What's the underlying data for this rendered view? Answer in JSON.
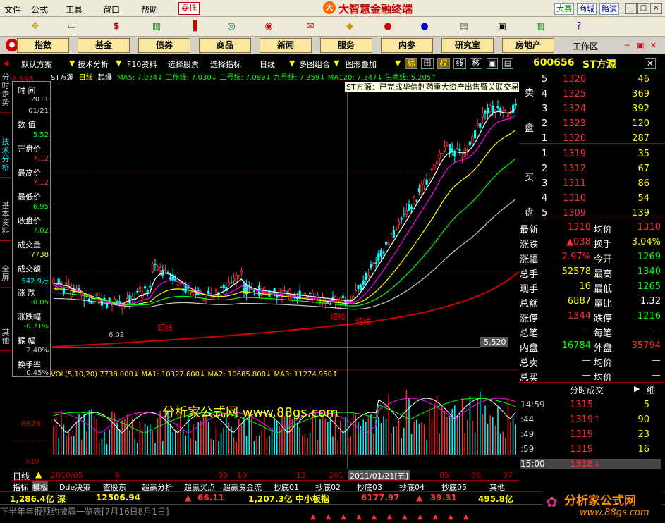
{
  "menubar": {
    "items": [
      "文件",
      "公式",
      "工具",
      "窗口",
      "帮助"
    ],
    "weituo": "委托",
    "brand": "大智慧金融终端",
    "right": [
      "大赛",
      "商城",
      "路演"
    ]
  },
  "navbar": {
    "items": [
      "指数",
      "基金",
      "债券",
      "商品",
      "新闻",
      "服务",
      "内参",
      "研究室",
      "房地产"
    ],
    "workspace": "工作区"
  },
  "toolbar": {
    "items": [
      "默认方案",
      "技术分析",
      "F10资料",
      "选择股票",
      "选择指标",
      "日线",
      "多图组合",
      "图形叠加"
    ],
    "small": [
      "标",
      "田",
      "权",
      "线",
      "移"
    ]
  },
  "stock": {
    "code": "600656",
    "name": "ST方源"
  },
  "indicator": {
    "name": "ST方源",
    "period": "日线",
    "ref": "起爆",
    "line": "MA5: 7.034↓ 工作线: 7.030↓ 二号线: 7.089↓ 九号线: 7.359↓ MA120: 7.347↓ 生命线: 5.205↑"
  },
  "news": "ST方源：已完成华信制药重大资产出售暨关联交易100%股权过户",
  "info": {
    "labels": [
      "时  间",
      "数  值",
      "开盘价",
      "最高价",
      "最低价",
      "收盘价",
      "成交量",
      "成交额",
      "涨  跌",
      "涨跌幅",
      "振  幅",
      "换手率"
    ],
    "values": [
      "2011",
      "01/21",
      "5.52",
      "7.12",
      "7.12",
      "6.95",
      "7.02",
      "7738",
      "542.9万",
      "-0.05",
      "-0.71%",
      "2.40%",
      "0.45%"
    ]
  },
  "chart_labels": {
    "low": "6.02",
    "short1": "短线",
    "short2": "短线",
    "short3": "短线",
    "price": "5.520",
    "left_price": "4.598"
  },
  "vol": {
    "line": "VOL(5,10,20) 7738.000↓ MA1: 10327.600↓ MA2: 10685.800↓ MA3: 11274.950↑",
    "watermark": "分析家公式网 www.88gs.com",
    "axis": "8878",
    "x10": "X10"
  },
  "dateaxis": {
    "labels": [
      "2010/05",
      "6",
      "09",
      "10",
      "12",
      "201"
    ],
    "cursor": "2011/01/21[五]",
    "right": [
      "05",
      "06",
      "07"
    ],
    "period": "日线"
  },
  "bottabs": [
    "指标",
    "模板",
    "Dde决策",
    "查股东",
    "超赢分析",
    "超赢买点",
    "超赢资金流",
    "抄底01",
    "抄底02",
    "抄底03",
    "抄底04",
    "抄底05",
    "其他"
  ],
  "ticker": {
    "sh": "1,286.4亿 深",
    "sh_val": "12506.94",
    "sh_chg": "66.11",
    "sm": "1,207.3亿 中小板指",
    "sm_val": "6177.97",
    "sm_chg": "39.31",
    "last": "495.8亿"
  },
  "status": {
    "text": "下半年年报预约披露一览表[7月16日8月1日]",
    "logo": "分析家公式网",
    "url": "www.88gs.com"
  },
  "sell": [
    {
      "n": "5",
      "p": "1326",
      "v": "46"
    },
    {
      "n": "4",
      "p": "1325",
      "v": "369"
    },
    {
      "n": "3",
      "p": "1324",
      "v": "392"
    },
    {
      "n": "2",
      "p": "1323",
      "v": "120"
    },
    {
      "n": "1",
      "p": "1320",
      "v": "287"
    }
  ],
  "buy": [
    {
      "n": "1",
      "p": "1319",
      "v": "35"
    },
    {
      "n": "2",
      "p": "1312",
      "v": "67"
    },
    {
      "n": "3",
      "p": "1311",
      "v": "86"
    },
    {
      "n": "4",
      "p": "1310",
      "v": "54"
    },
    {
      "n": "5",
      "p": "1309",
      "v": "139"
    }
  ],
  "book_labels": {
    "sell": "卖盘",
    "buy": "买盘"
  },
  "stats": [
    {
      "k1": "最新",
      "v1": "1318",
      "k2": "均价",
      "v2": "1310"
    },
    {
      "k1": "涨跌",
      "v1": "▲038",
      "k2": "换手",
      "v2": "3.04%"
    },
    {
      "k1": "涨幅",
      "v1": "2.97%",
      "k2": "今开",
      "v2": "1269"
    },
    {
      "k1": "总手",
      "v1": "52578",
      "k2": "最高",
      "v2": "1340"
    },
    {
      "k1": "现手",
      "v1": "16",
      "k2": "最低",
      "v2": "1265"
    },
    {
      "k1": "总额",
      "v1": "6887",
      "k2": "量比",
      "v2": "1.32"
    },
    {
      "k1": "涨停",
      "v1": "1344",
      "k2": "跌停",
      "v2": "1216"
    },
    {
      "k1": "总笔",
      "v1": "—",
      "k2": "每笔",
      "v2": "—"
    },
    {
      "k1": "内盘",
      "v1": "16784",
      "k2": "外盘",
      "v2": "35794"
    },
    {
      "k1": "总卖",
      "v1": "—",
      "k2": "均价",
      "v2": "—"
    },
    {
      "k1": "总买",
      "v1": "—",
      "k2": "均价",
      "v2": "—"
    }
  ],
  "ticks": {
    "title": "分时成交",
    "detail": "细",
    "rows": [
      {
        "t": "14:59",
        "p": "1315",
        "v": "5"
      },
      {
        "t": ":44",
        "p": "1319↑",
        "v": "90"
      },
      {
        "t": ":49",
        "p": "1319",
        "v": "23"
      },
      {
        "t": ":59",
        "p": "1319",
        "v": "16"
      },
      {
        "t": "15:00",
        "p": "1318↓",
        "v": ""
      }
    ]
  },
  "sidetabs": [
    "分时走势",
    "技术分析",
    "基本资料",
    "全屏",
    "其他"
  ]
}
